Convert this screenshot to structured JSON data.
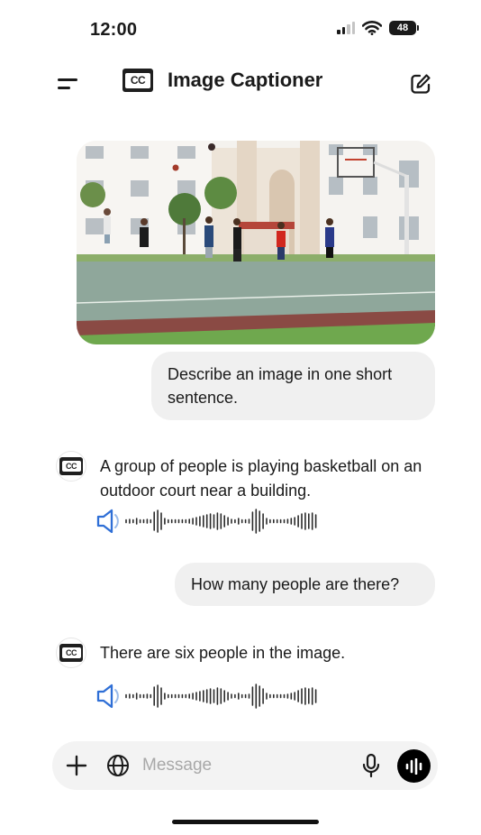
{
  "status_bar": {
    "time": "12:00",
    "battery": "48",
    "icons": [
      "signal-icon",
      "wifi-icon",
      "battery-icon"
    ]
  },
  "header": {
    "logo_text": "CC",
    "title": "Image Captioner",
    "icons": [
      "menu-icon",
      "compose-icon"
    ]
  },
  "conversation": {
    "image": {
      "description_icon": "basketball-court-photo"
    },
    "messages": [
      {
        "role": "user",
        "text": "Describe an image in one short sentence."
      },
      {
        "role": "assistant",
        "text": "A group of people is playing basketball on an outdoor court near a building."
      },
      {
        "role": "user",
        "text": "How many people are there?"
      },
      {
        "role": "assistant",
        "text": "There are six people in the image."
      }
    ]
  },
  "input_bar": {
    "placeholder": "Message",
    "value": "",
    "icons": [
      "plus-icon",
      "globe-icon",
      "mic-icon",
      "voice-mode-icon"
    ]
  },
  "colors": {
    "accent_blue": "#2f6fd6",
    "bubble_bg": "#f0f0f0",
    "text": "#1a1a1a"
  }
}
